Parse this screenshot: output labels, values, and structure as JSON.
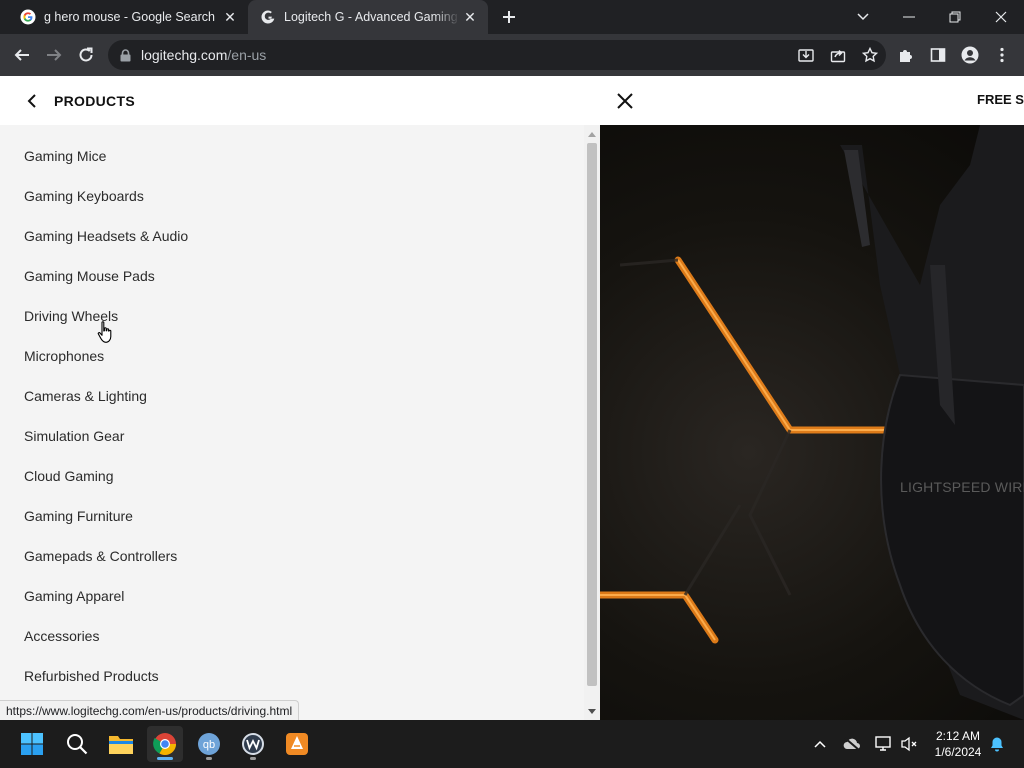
{
  "browser": {
    "tabs": [
      {
        "title": "g hero mouse - Google Search",
        "favicon": "google-g-icon",
        "active": false
      },
      {
        "title": "Logitech G - Advanced Gaming Peripherals",
        "favicon": "logitech-g-icon",
        "active": true
      }
    ],
    "address": {
      "host": "logitechg.com",
      "path": "/en-us"
    },
    "status_url": "https://www.logitechg.com/en-us/products/driving.html"
  },
  "panel": {
    "title": "PRODUCTS",
    "categories": [
      "Gaming Mice",
      "Gaming Keyboards",
      "Gaming Headsets & Audio",
      "Gaming Mouse Pads",
      "Driving Wheels",
      "Microphones",
      "Cameras & Lighting",
      "Simulation Gear",
      "Cloud Gaming",
      "Gaming Furniture",
      "Gamepads & Controllers",
      "Gaming Apparel",
      "Accessories",
      "Refurbished Products"
    ]
  },
  "right": {
    "promo": "FREE SH",
    "hero_text": "LIGHTSPEED WIRE"
  },
  "taskbar": {
    "time": "2:12 AM",
    "date": "1/6/2024"
  },
  "colors": {
    "accent_orange": "#ff8c1a",
    "taskbar_active": "#5fb2f2"
  }
}
